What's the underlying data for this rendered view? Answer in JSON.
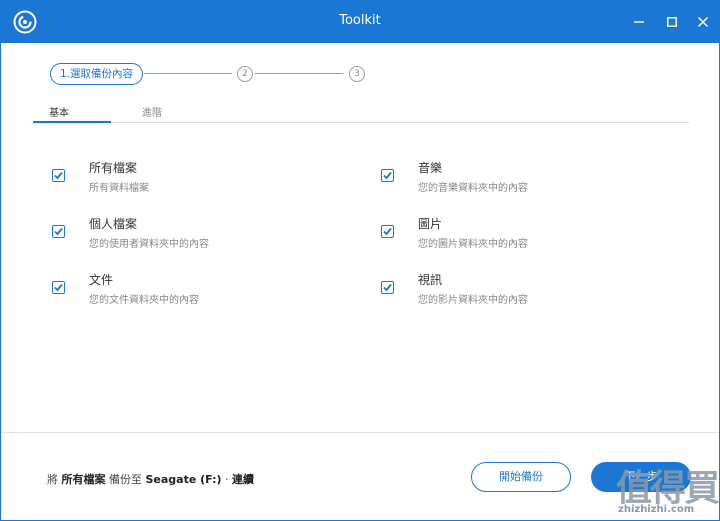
{
  "window": {
    "title": "Toolkit"
  },
  "app_icon": "app-logo-icon",
  "window_controls": [
    "minimize-icon",
    "maximize-icon",
    "close-icon"
  ],
  "stepper": {
    "step1": "1.選取備份內容",
    "step2": "2",
    "step3": "3"
  },
  "tabs": {
    "basic": "基本",
    "advanced": "進階"
  },
  "options": [
    {
      "title": "所有檔案",
      "desc": "所有資料檔案",
      "checked": true
    },
    {
      "title": "音樂",
      "desc": "您的音樂資料夾中的內容",
      "checked": true
    },
    {
      "title": "個人檔案",
      "desc": "您的使用者資料夾中的內容",
      "checked": true
    },
    {
      "title": "圖片",
      "desc": "您的圖片資料夾中的內容",
      "checked": true
    },
    {
      "title": "文件",
      "desc": "您的文件資料夾中的內容",
      "checked": true
    },
    {
      "title": "視訊",
      "desc": "您的影片資料夾中的內容",
      "checked": true
    }
  ],
  "footer": {
    "prefix": "將 ",
    "what": "所有檔案",
    "middle": " 備份至 ",
    "target": "Seagate (F:)",
    "sep": " · ",
    "mode": "連續"
  },
  "buttons": {
    "start": "開始備份",
    "next": "下一步"
  },
  "watermark": {
    "logo": "值得買",
    "url": "zhizhizhi.com"
  },
  "colors": {
    "accent": "#1a78d4",
    "text": "#333333",
    "muted": "#888888"
  }
}
